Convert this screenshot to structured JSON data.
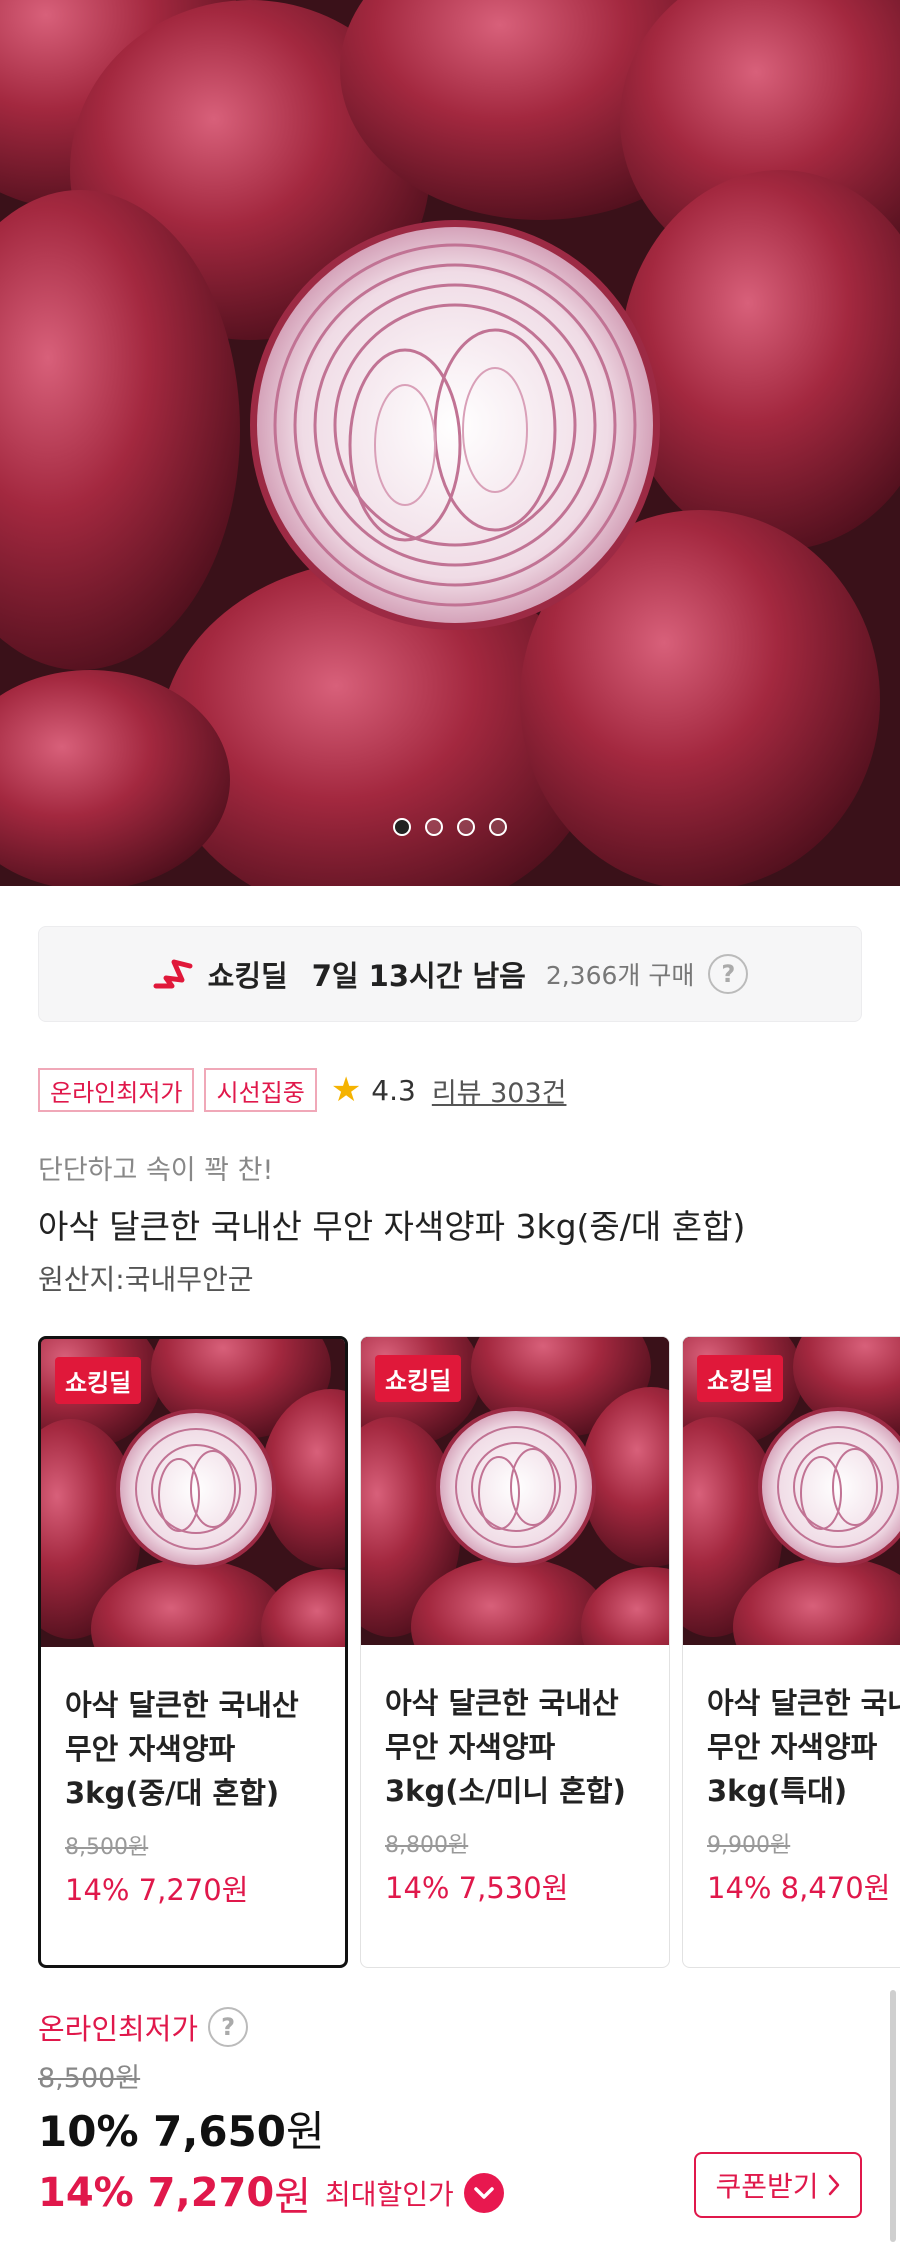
{
  "hero": {
    "image_alt": "red onions with a halved onion in the center",
    "pager": {
      "total": 4,
      "active": 0
    }
  },
  "deal_bar": {
    "logo_icon": "shocking-deal-logo",
    "name": "쇼킹딜",
    "time_left": "7일 13시간 남음",
    "purchase_count": "2,366개 구매",
    "help": "?"
  },
  "badges": [
    "온라인최저가",
    "시선집중"
  ],
  "rating": {
    "score": "4.3",
    "review_label": "리뷰 303건"
  },
  "product": {
    "subtitle": "단단하고 속이 꽉 찬!",
    "title": "아삭 달큰한 국내산 무안 자색양파 3kg(중/대 혼합)",
    "origin": "원산지:국내무안군"
  },
  "options": [
    {
      "badge": "쇼킹딜",
      "line1": "아삭 달큰한 국내산",
      "line2": "무안 자색양파",
      "line3": "3kg(중/대 혼합)",
      "original_price": "8,500원",
      "sale": "14% 7,270원"
    },
    {
      "badge": "쇼킹딜",
      "line1": "아삭 달큰한 국내산",
      "line2": "무안 자색양파",
      "line3": "3kg(소/미니 혼합)",
      "original_price": "8,800원",
      "sale": "14% 7,530원"
    },
    {
      "badge": "쇼킹딜",
      "line1": "아삭 달큰한 국내산",
      "line2": "무안 자색양파",
      "line3": "3kg(특대)",
      "original_price": "9,900원",
      "sale": "14% 8,470원"
    }
  ],
  "price": {
    "label": "온라인최저가",
    "help": "?",
    "original": "8,500원",
    "main_discount": "10% 7,650",
    "main_unit": "원",
    "max_discount": "14% 7,270",
    "max_unit": "원",
    "max_label": "최대할인가",
    "coupon_button": "쿠폰받기",
    "coupon_icon": "chevron-right-icon"
  },
  "colors": {
    "accent": "#e0184b",
    "onion": "#8a1f34"
  }
}
